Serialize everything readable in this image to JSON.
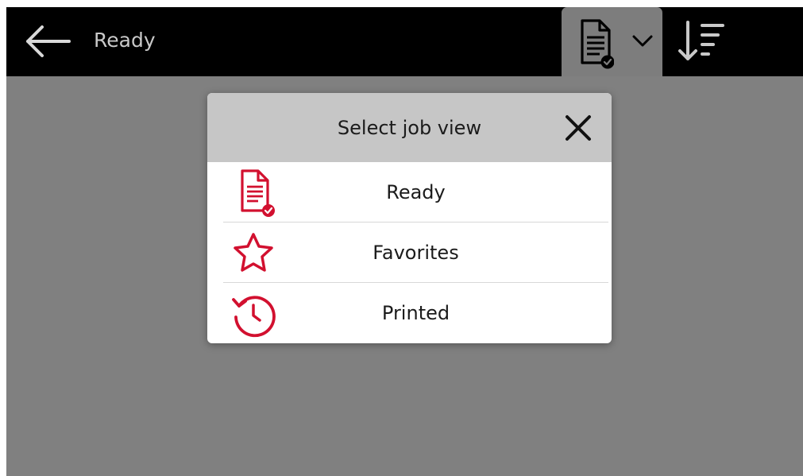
{
  "header": {
    "back_icon": "arrow-left-icon",
    "title": "Ready",
    "view_icon": "document-check-icon",
    "dropdown_icon": "chevron-down-icon",
    "sort_icon": "sort-descending-icon"
  },
  "dialog": {
    "title": "Select job view",
    "close_icon": "close-icon",
    "options": [
      {
        "label": "Ready",
        "icon": "document-check-icon"
      },
      {
        "label": "Favorites",
        "icon": "star-icon"
      },
      {
        "label": "Printed",
        "icon": "history-icon"
      }
    ]
  },
  "colors": {
    "topbar": "#000000",
    "background": "#808080",
    "dialog_header": "#c6c6c6",
    "accent": "#d2102f"
  }
}
